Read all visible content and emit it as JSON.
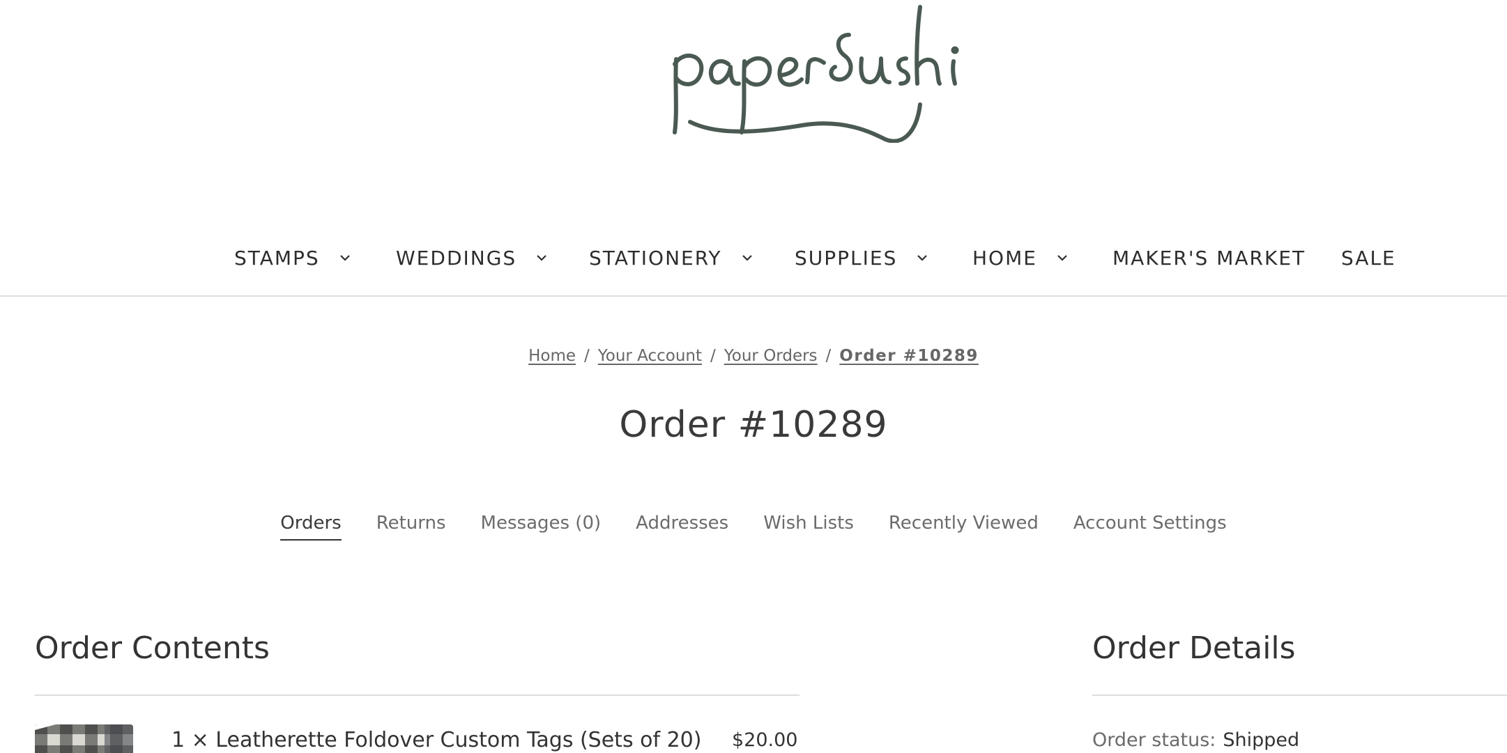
{
  "brand": {
    "logo_text": "paper sushi",
    "logo_color": "#4a5a52"
  },
  "nav": {
    "items": [
      {
        "label": "STAMPS",
        "has_dropdown": true
      },
      {
        "label": "WEDDINGS",
        "has_dropdown": true
      },
      {
        "label": "STATIONERY",
        "has_dropdown": true
      },
      {
        "label": "SUPPLIES",
        "has_dropdown": true
      },
      {
        "label": "HOME",
        "has_dropdown": true
      },
      {
        "label": "MAKER'S MARKET",
        "has_dropdown": false
      },
      {
        "label": "SALE",
        "has_dropdown": false
      }
    ]
  },
  "breadcrumb": {
    "items": [
      "Home",
      "Your Account",
      "Your Orders",
      "Order #10289"
    ],
    "separator": "/"
  },
  "page": {
    "title": "Order #10289"
  },
  "account_tabs": {
    "items": [
      "Orders",
      "Returns",
      "Messages (0)",
      "Addresses",
      "Wish Lists",
      "Recently Viewed",
      "Account Settings"
    ],
    "active": "Orders"
  },
  "order_contents": {
    "heading": "Order Contents",
    "items": [
      {
        "name": "1 × Leatherette Foldover Custom Tags (Sets of 20)",
        "price": "$20.00",
        "thumb_icon": "buffalo-check-product-thumbnail"
      }
    ]
  },
  "order_details": {
    "heading": "Order Details",
    "status_label": "Order status:",
    "status_value": "Shipped"
  },
  "colors": {
    "text": "#333333",
    "muted": "#6b6b6b",
    "divider": "#dedede"
  }
}
